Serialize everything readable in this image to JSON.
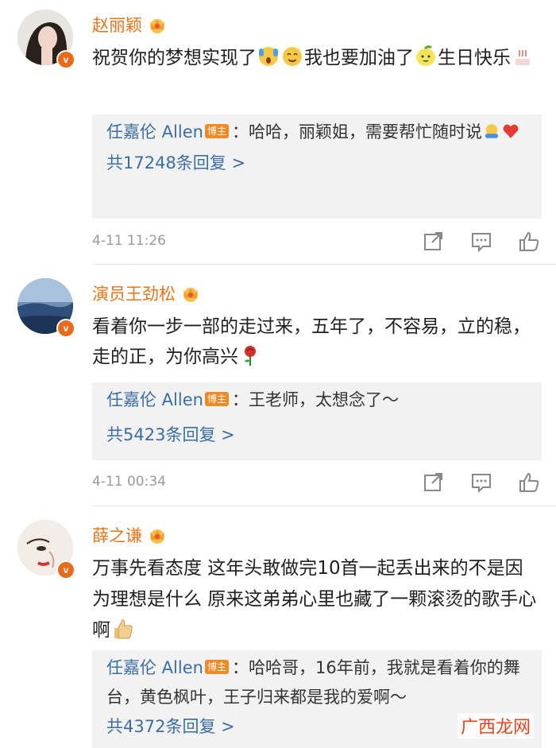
{
  "comments": [
    {
      "username": "赵丽颖",
      "text_parts": [
        "祝贺你的梦想实现了",
        "我也要加油了",
        "生日快乐"
      ],
      "reply": {
        "author": "任嘉伦 Allen",
        "tag": "博主",
        "text_parts": [
          "：哈哈，丽颖姐，需要帮忙随时说"
        ],
        "count_label": "共17248条回复 >"
      },
      "time": "4-11 11:26"
    },
    {
      "username": "演员王劲松",
      "text_parts": [
        "看着你一步一部的走过来，五年了，不容易，立的稳，走的正，为你高兴"
      ],
      "reply": {
        "author": "任嘉伦 Allen",
        "tag": "博主",
        "text_parts": [
          "：王老师，太想念了～"
        ],
        "count_label": "共5423条回复 >"
      },
      "time": "4-11 00:34"
    },
    {
      "username": "薛之谦",
      "text_parts": [
        "万事先看态度 这年头敢做完10首一起丢出来的不是因为理想是什么 原来这弟弟心里也藏了一颗滚烫的歌手心啊"
      ],
      "reply": {
        "author": "任嘉伦 Allen",
        "tag": "博主",
        "text_parts": [
          "：哈哈哥，16年前，我就是看着你的舞台，黄色枫叶，王子归来都是我的爱啊～"
        ],
        "count_label": "共4372条回复 >"
      }
    }
  ],
  "verified_badge": "v",
  "watermark": "广西龙网",
  "icons": {
    "crown": "vip-crown-icon",
    "share": "share-icon",
    "comment": "comment-icon",
    "like": "like-thumb-icon"
  },
  "colors": {
    "username": "#e5741d",
    "link": "#3b6ea5",
    "tag_bg": "#f08a24",
    "badge": "#e86b1d"
  }
}
